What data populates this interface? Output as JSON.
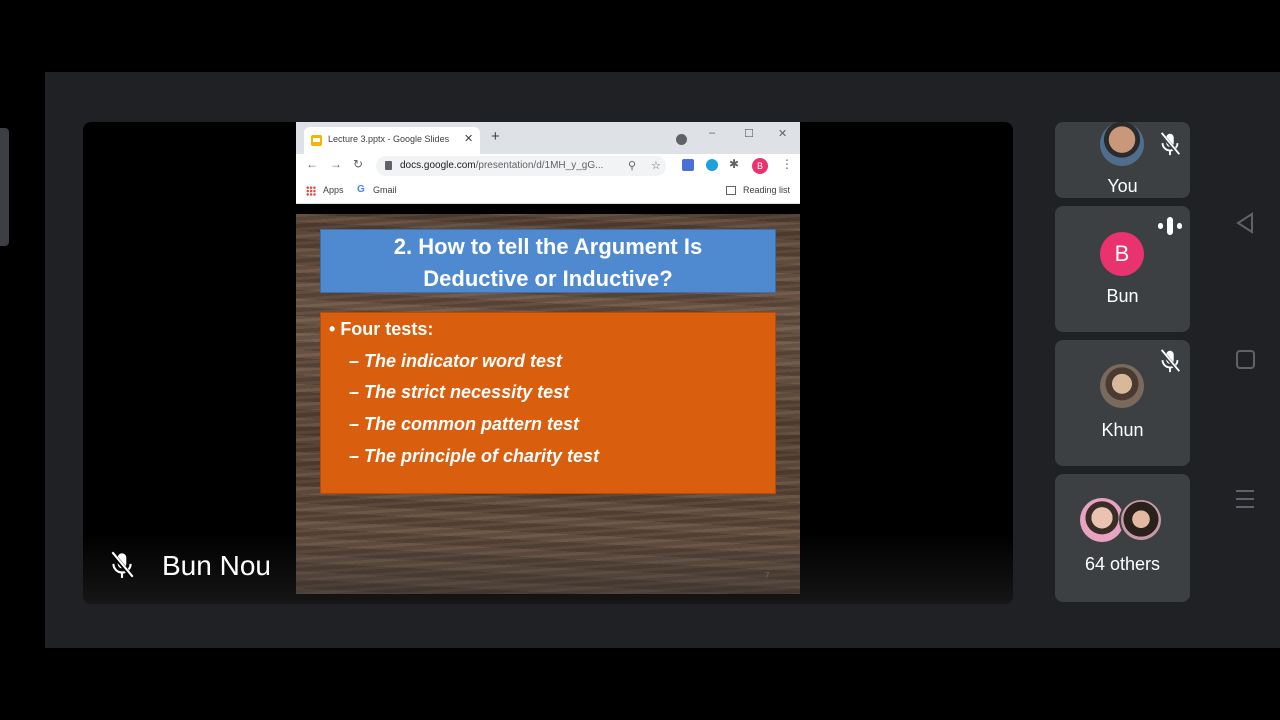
{
  "browser": {
    "tab_title": "Lecture 3.pptx - Google Slides",
    "tab_close": "✕",
    "new_tab": "+",
    "window_min": "–",
    "window_max": "☐",
    "window_close": "✕",
    "url_host": "docs.google.com",
    "url_path": "/presentation/d/1MH_y_gG...",
    "profile_initial": "B",
    "bookmarks": {
      "apps": "Apps",
      "gmail": "Gmail",
      "reading_list": "Reading list"
    }
  },
  "slide": {
    "title_line1": "2. How to tell the Argument Is",
    "title_line2": "Deductive or Inductive?",
    "bullet": "Four tests:",
    "subitems": [
      "The indicator word test",
      "The strict necessity test",
      "The common pattern test",
      "The principle of charity test"
    ],
    "page_number": "7"
  },
  "presenter": {
    "name": "Bun Nou",
    "muted": true
  },
  "participants": [
    {
      "name": "You",
      "muted": true
    },
    {
      "name": "Bun",
      "initial": "B",
      "speaking": true
    },
    {
      "name": "Khun",
      "muted": true
    },
    {
      "name": "64 others"
    }
  ],
  "colors": {
    "stage": "#202124",
    "tile": "#3c4043",
    "title_box": "#4f8ad1",
    "body_box": "#d95e0e",
    "avatar_pink": "#e8336f"
  },
  "icons": [
    "mic-off-icon",
    "speaking-icon",
    "back-icon",
    "home-icon",
    "recents-icon",
    "lock-icon",
    "star-icon",
    "zoom-icon",
    "puzzle-icon"
  ]
}
